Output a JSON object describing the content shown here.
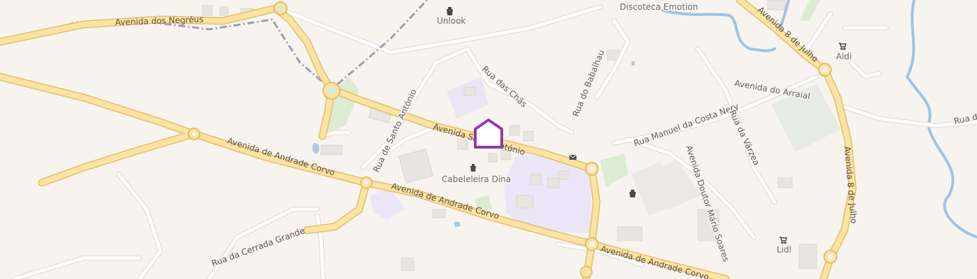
{
  "map": {
    "roads": {
      "avenida_negreus": "Avenida dos Negréus",
      "avenida_santo_antonio": "Avenida Santo António",
      "avenida_andrade_corvo_1": "Avenida de Andrade Corvo",
      "avenida_andrade_corvo_2": "Avenida de Andrade Corvo",
      "avenida_andrade_corvo_3": "Avenida de Andrade Corvo",
      "rua_santo_antonio": "Rua de Santo António",
      "rua_chas": "Rua das Chãs",
      "rua_babalhau": "Rua do Babalhau",
      "rua_manuel_costa_nery": "Rua Manuel da Costa Nery",
      "avenida_doutor_mario_soares": "Avenida Doutor Mário Soares",
      "rua_varzea": "Rua da Várzea",
      "avenida_arraial": "Avenida do Arraial",
      "avenida_8_julho_1": "Avenida 8 de Julho",
      "avenida_8_julho_2": "Avenida 8 de Julho",
      "rua_cerrada_grande": "Rua da Cerrada Grande",
      "rua_partial": "Rua da"
    },
    "pois": {
      "unlook": "Unlook",
      "discoteca": "Discoteca Emotion",
      "aldi": "Aldi",
      "lidl": "Lidl",
      "cabeleireira": "Cabeleleira Dina"
    },
    "colors": {
      "background": "#f7f4f0",
      "major_road": "#fbe3a4",
      "major_road_casing": "#e3be66",
      "minor_road": "#ffffff",
      "water": "#9fc4e3",
      "park": "#dcebd2",
      "education": "#ebe6f7",
      "marker": "#8e3ba8"
    },
    "icons": [
      "shop-bag-icon",
      "shopping-cart-icon",
      "mail-icon",
      "home-marker-icon",
      "roundabout-icon"
    ]
  }
}
